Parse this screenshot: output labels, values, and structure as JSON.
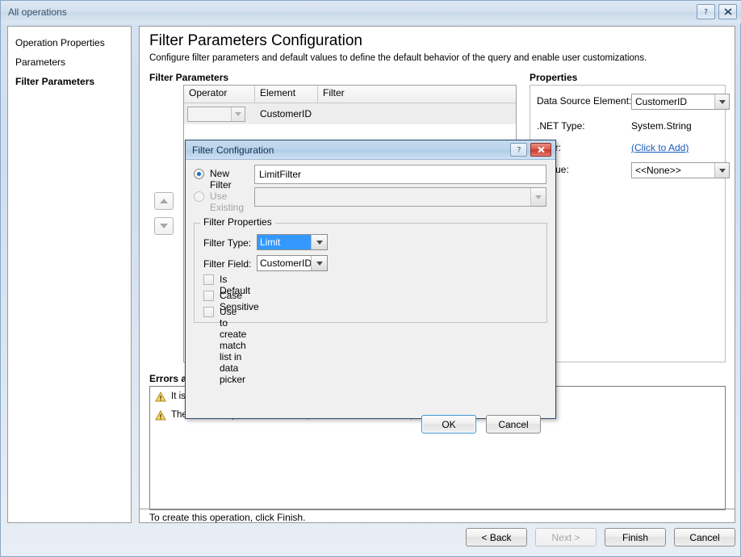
{
  "window": {
    "title": "All operations",
    "help_button": "?",
    "close_button": "x"
  },
  "sidebar": {
    "items": [
      {
        "label": "Operation Properties",
        "active": false
      },
      {
        "label": "Parameters",
        "active": false
      },
      {
        "label": "Filter Parameters",
        "active": true
      }
    ]
  },
  "main": {
    "title": "Filter Parameters Configuration",
    "subtitle": "Configure filter parameters and default values to define the default behavior of the query and enable user customizations.",
    "filter_params_label": "Filter Parameters",
    "properties_label": "Properties",
    "errors_label": "Errors an",
    "footer_note": "To create this operation, click Finish."
  },
  "grid": {
    "columns": [
      "Operator",
      "Element",
      "Filter"
    ],
    "rows": [
      {
        "operator": "",
        "element": "CustomerID",
        "filter": ""
      }
    ]
  },
  "properties": {
    "rows": [
      {
        "label": "Data Source Element:",
        "value": "CustomerID",
        "type": "combo"
      },
      {
        "label": ".NET Type:",
        "value": "System.String",
        "type": "text"
      },
      {
        "label": "Filter:",
        "value": "(Click to Add)",
        "type": "link"
      },
      {
        "label": "t Value:",
        "value": "<<None>>",
        "type": "combo"
      }
    ]
  },
  "errors": {
    "items": [
      {
        "text": "It is  s                                                                    this operation may result in large result sets."
      },
      {
        "text": "Ther                                                                    s will be ignored when the operation definition is completed."
      }
    ]
  },
  "wizard_buttons": [
    {
      "label": "< Back",
      "disabled": false
    },
    {
      "label": "Next >",
      "disabled": true
    },
    {
      "label": "Finish",
      "disabled": false
    },
    {
      "label": "Cancel",
      "disabled": false
    }
  ],
  "dialog": {
    "title": "Filter Configuration",
    "help_button": "?",
    "close_button": "x",
    "new_filter": {
      "label": "New Filter",
      "selected": true,
      "value": "LimitFilter"
    },
    "use_existing": {
      "label": "Use Existing",
      "selected": false,
      "disabled": true,
      "value": ""
    },
    "group_title": "Filter Properties",
    "filter_type": {
      "label": "Filter Type:",
      "value": "Limit",
      "highlighted": true
    },
    "filter_field": {
      "label": "Filter Field:",
      "value": "CustomerID",
      "highlighted": false
    },
    "checkboxes": [
      {
        "label": "Is Default",
        "checked": false
      },
      {
        "label": "Case Sensitive",
        "checked": false
      },
      {
        "label": "Use to create match list in data picker",
        "checked": false
      }
    ],
    "ok_label": "OK",
    "cancel_label": "Cancel"
  },
  "colors": {
    "selection_blue": "#3399ff",
    "link_blue": "#1a58bd",
    "warning_amber": "#f0c419",
    "close_red": "#c9372c"
  }
}
